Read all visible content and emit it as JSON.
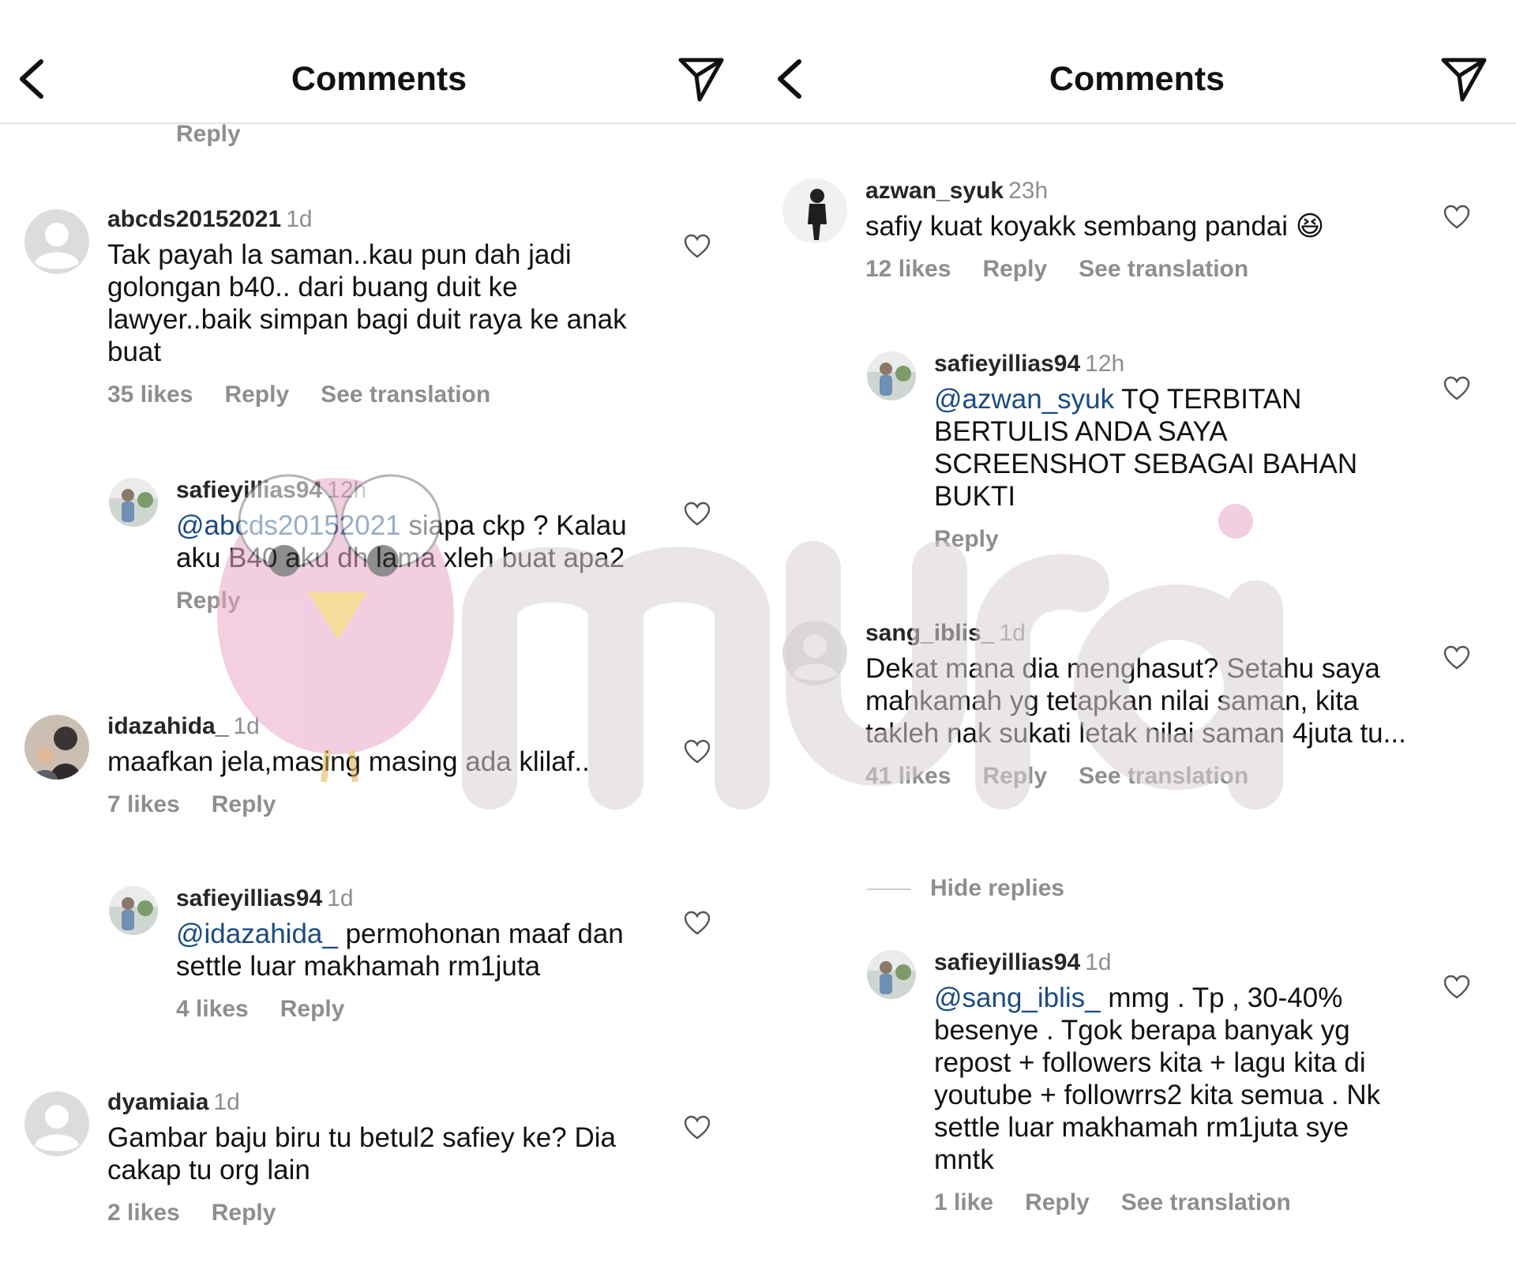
{
  "left": {
    "header": {
      "title": "Comments"
    },
    "top_reply_label": "Reply",
    "comments": [
      {
        "username": "abcds20152021",
        "time": "1d",
        "mention": "",
        "text": "Tak payah la saman..kau pun dah jadi golongan b40.. dari buang duit ke lawyer..baik simpan bagi duit raya ke anak buat",
        "likes": "35 likes",
        "reply": "Reply",
        "translate": "See translation"
      },
      {
        "username": "safieyillias94",
        "time": "12h",
        "mention": "@abcds20152021",
        "text": " siapa ckp ? Kalau aku B40 aku dh lama xleh buat apa2",
        "likes": "",
        "reply": "Reply",
        "translate": ""
      },
      {
        "username": "idazahida_",
        "time": "1d",
        "mention": "",
        "text": "maafkan jela,masing masing ada klilaf..",
        "likes": "7 likes",
        "reply": "Reply",
        "translate": ""
      },
      {
        "username": "safieyillias94",
        "time": "1d",
        "mention": "@idazahida_",
        "text": " permohonan maaf dan settle luar makhamah rm1juta",
        "likes": "4 likes",
        "reply": "Reply",
        "translate": ""
      },
      {
        "username": "dyamiaia",
        "time": "1d",
        "mention": "",
        "text": "Gambar baju biru tu betul2 safiey ke? Dia cakap tu org lain",
        "likes": "2 likes",
        "reply": "Reply",
        "translate": ""
      }
    ]
  },
  "right": {
    "header": {
      "title": "Comments"
    },
    "hide_replies": "Hide replies",
    "comments": [
      {
        "username": "azwan_syuk",
        "time": "23h",
        "mention": "",
        "text": "safiy kuat koyakk sembang pandai 😆",
        "likes": "12 likes",
        "reply": "Reply",
        "translate": "See translation"
      },
      {
        "username": "safieyillias94",
        "time": "12h",
        "mention": "@azwan_syuk",
        "text": " TQ TERBITAN BERTULIS ANDA SAYA SCREENSHOT SEBAGAI BAHAN BUKTI",
        "likes": "",
        "reply": "Reply",
        "translate": ""
      },
      {
        "username": "sang_iblis_",
        "time": "1d",
        "mention": "",
        "text": "Dekat mana dia menghasut? Setahu saya mahkamah yg tetapkan nilai saman, kita takleh nak sukati letak nilai saman 4juta tu...",
        "likes": "41 likes",
        "reply": "Reply",
        "translate": "See translation"
      },
      {
        "username": "safieyillias94",
        "time": "1d",
        "mention": "@sang_iblis_",
        "text": " mmg . Tp , 30-40% besenye . Tgok berapa banyak yg repost + followers kita + lagu kita di youtube + followrrs2 kita semua . Nk settle luar makhamah rm1juta sye mntk",
        "likes": "1 like",
        "reply": "Reply",
        "translate": "See translation"
      }
    ]
  },
  "watermark": {
    "text": "murai",
    "color": "#e8a6c8"
  },
  "colors": {
    "mention": "#1b4b82",
    "muted": "#8e8e8e",
    "divider": "#e3e3e3"
  }
}
